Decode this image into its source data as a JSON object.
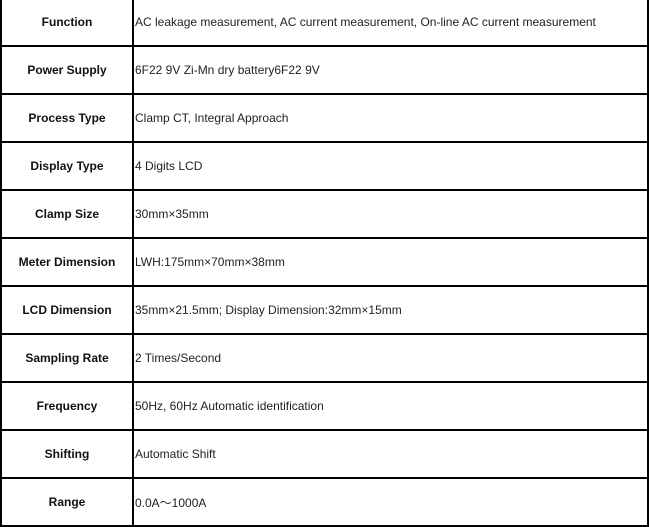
{
  "rows": [
    {
      "label": "Function",
      "value": "AC leakage measurement, AC current measurement, On-line AC current measurement"
    },
    {
      "label": "Power Supply",
      "value": "6F22 9V  Zi-Mn dry battery6F22 9V"
    },
    {
      "label": "Process Type",
      "value": "Clamp CT, Integral Approach"
    },
    {
      "label": "Display Type",
      "value": "4 Digits LCD"
    },
    {
      "label": "Clamp Size",
      "value": "30mm×35mm"
    },
    {
      "label": "Meter Dimension",
      "value": "LWH:175mm×70mm×38mm"
    },
    {
      "label": "LCD Dimension",
      "value": "35mm×21.5mm; Display Dimension:32mm×15mm"
    },
    {
      "label": "Sampling Rate",
      "value": "2 Times/Second"
    },
    {
      "label": "Frequency",
      "value": "50Hz, 60Hz Automatic identification"
    },
    {
      "label": "Shifting",
      "value": "Automatic Shift"
    },
    {
      "label": "Range",
      "value": "0.0A～1000A"
    }
  ]
}
